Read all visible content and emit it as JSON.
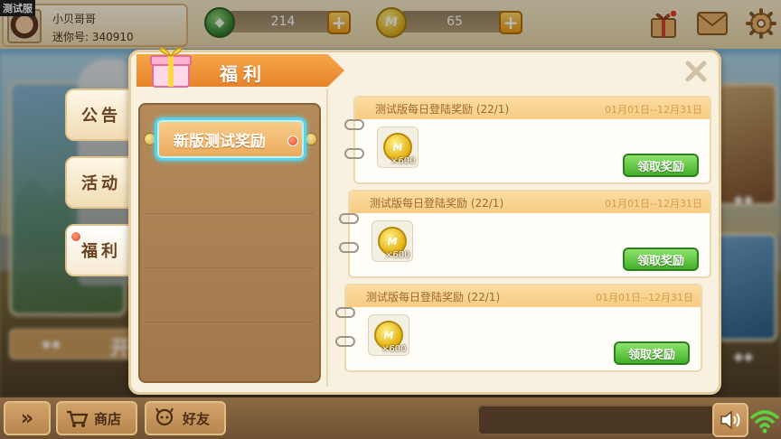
{
  "debug_label": "测试服",
  "profile": {
    "nickname": "小贝哥哥",
    "mini_id": "迷你号: 340910"
  },
  "currency": [
    {
      "name": "green-coin",
      "value": "214",
      "color": "#3a8a35"
    },
    {
      "name": "gold-coin",
      "value": "65",
      "color": "#e3b10f"
    }
  ],
  "top_icons": [
    "gift-box-icon",
    "mail-icon",
    "gear-icon"
  ],
  "side_tabs": [
    {
      "label": "公告",
      "active": false
    },
    {
      "label": "活动",
      "active": false
    },
    {
      "label": "福利",
      "active": true
    }
  ],
  "panel": {
    "title": "福利",
    "category": {
      "label": "新版测试奖励"
    },
    "rewards": [
      {
        "title": "测试版每日登陆奖励 (22/1)",
        "date": "01月01日--12月31日",
        "item_qty": "×600",
        "button": "领取奖励"
      },
      {
        "title": "测试版每日登陆奖励 (22/1)",
        "date": "01月01日--12月31日",
        "item_qty": "×600",
        "button": "领取奖励"
      },
      {
        "title": "测试版每日登陆奖励 (22/1)",
        "date": "01月01日--12月31日",
        "item_qty": "×600",
        "button": "领取奖励"
      }
    ]
  },
  "background": {
    "start_label": "开"
  },
  "bottom": {
    "expand_label": "»",
    "shop_label": "商店",
    "friends_label": "好友"
  },
  "colors": {
    "accent_orange": "#e7832b",
    "claim_green": "#42b02a",
    "selected_outline": "#59d2e6"
  }
}
